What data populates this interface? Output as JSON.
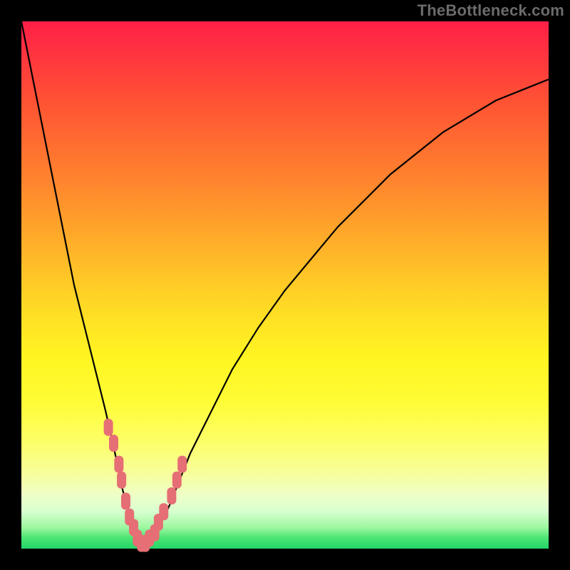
{
  "watermark": "TheBottleneck.com",
  "colors": {
    "frame": "#000000",
    "curve": "#000000",
    "marker": "#e56f75",
    "gradient_top": "#ff1f47",
    "gradient_bottom": "#22d66a"
  },
  "chart_data": {
    "type": "line",
    "title": "",
    "xlabel": "",
    "ylabel": "",
    "xlim": [
      0,
      100
    ],
    "ylim": [
      0,
      100
    ],
    "series": [
      {
        "name": "bottleneck-curve",
        "x": [
          0,
          2,
          4,
          6,
          8,
          10,
          12,
          14,
          16,
          18,
          19,
          20,
          21,
          22,
          23,
          24,
          25,
          26,
          28,
          30,
          32,
          35,
          40,
          45,
          50,
          55,
          60,
          65,
          70,
          75,
          80,
          85,
          90,
          95,
          100
        ],
        "values": [
          100,
          90,
          80,
          70,
          60,
          50,
          42,
          34,
          26,
          17,
          12,
          8,
          5,
          2,
          1,
          1,
          2,
          4,
          8,
          13,
          18,
          24,
          34,
          42,
          49,
          55,
          61,
          66,
          71,
          75,
          79,
          82,
          85,
          87,
          89
        ]
      }
    ],
    "markers": {
      "name": "highlighted-points",
      "x": [
        16.5,
        17.5,
        18.5,
        19.0,
        19.8,
        20.5,
        21.3,
        22.0,
        22.8,
        23.5,
        24.3,
        25.3,
        26.0,
        27.0,
        28.5,
        29.5,
        30.5
      ],
      "values": [
        23,
        20,
        16,
        13,
        9,
        6,
        4,
        2,
        1,
        1,
        2,
        3,
        5,
        7,
        10,
        13,
        16
      ]
    }
  }
}
